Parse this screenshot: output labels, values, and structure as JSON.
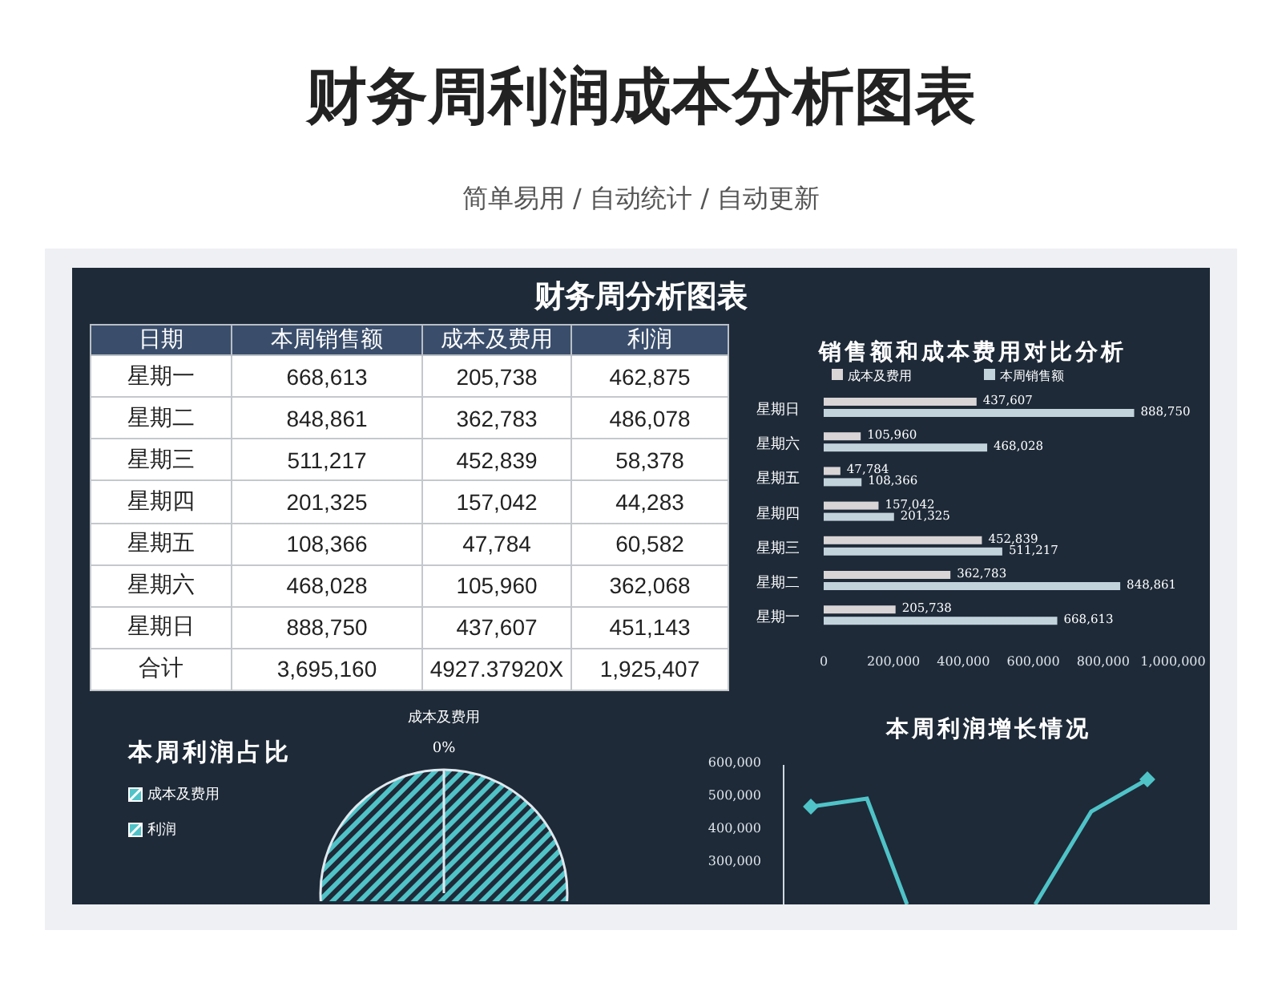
{
  "page": {
    "title": "财务周利润成本分析图表",
    "subtitle": "简单易用 / 自动统计 / 自动更新"
  },
  "dashboard": {
    "title": "财务周分析图表",
    "table": {
      "columns": [
        "日期",
        "本周销售额",
        "成本及费用",
        "利润"
      ],
      "rows": [
        [
          "星期一",
          "668,613",
          "205,738",
          "462,875"
        ],
        [
          "星期二",
          "848,861",
          "362,783",
          "486,078"
        ],
        [
          "星期三",
          "511,217",
          "452,839",
          "58,378"
        ],
        [
          "星期四",
          "201,325",
          "157,042",
          "44,283"
        ],
        [
          "星期五",
          "108,366",
          "47,784",
          "60,582"
        ],
        [
          "星期六",
          "468,028",
          "105,960",
          "362,068"
        ],
        [
          "星期日",
          "888,750",
          "437,607",
          "451,143"
        ],
        [
          "合计",
          "3,695,160",
          "4927.37920X",
          "1,925,407"
        ]
      ]
    },
    "bar_chart": {
      "chart_data": {
        "type": "bar",
        "orientation": "horizontal",
        "title": "销售额和成本费用对比分析",
        "categories": [
          "星期日",
          "星期六",
          "星期五",
          "星期四",
          "星期三",
          "星期二",
          "星期一"
        ],
        "series": [
          {
            "name": "成本及费用",
            "color": "#d9d4d6",
            "values": [
              437607,
              105960,
              47784,
              157042,
              452839,
              362783,
              205738
            ]
          },
          {
            "name": "本周销售额",
            "color": "#c3d3dc",
            "values": [
              888750,
              468028,
              108366,
              201325,
              511217,
              848861,
              668613
            ]
          }
        ],
        "xlim": [
          0,
          1000000
        ],
        "xticks": [
          {
            "value": 0,
            "label": "0"
          },
          {
            "value": 200000,
            "label": "200,000"
          },
          {
            "value": 400000,
            "label": "400,000"
          },
          {
            "value": 600000,
            "label": "600,000"
          },
          {
            "value": 800000,
            "label": "800,000"
          },
          {
            "value": 1000000,
            "label": "1,000,000"
          }
        ],
        "legend": "top",
        "value_labels": [
          [
            "437,607",
            "105,960",
            "47,784",
            "157,042",
            "452,839",
            "362,783",
            "205,738"
          ],
          [
            "888,750",
            "468,028",
            "108,366",
            "201,325",
            "511,217",
            "848,861",
            "668,613"
          ]
        ]
      }
    },
    "pie_chart": {
      "title": "本周利润占比",
      "legend": [
        {
          "label": "成本及费用"
        },
        {
          "label": "利润"
        }
      ],
      "slice_label": {
        "name": "成本及费用",
        "value": "0%"
      }
    },
    "line_chart": {
      "title": "本周利润增长情况",
      "y_axis_labels": [
        "600,000",
        "500,000",
        "400,000",
        "300,000"
      ]
    }
  }
}
